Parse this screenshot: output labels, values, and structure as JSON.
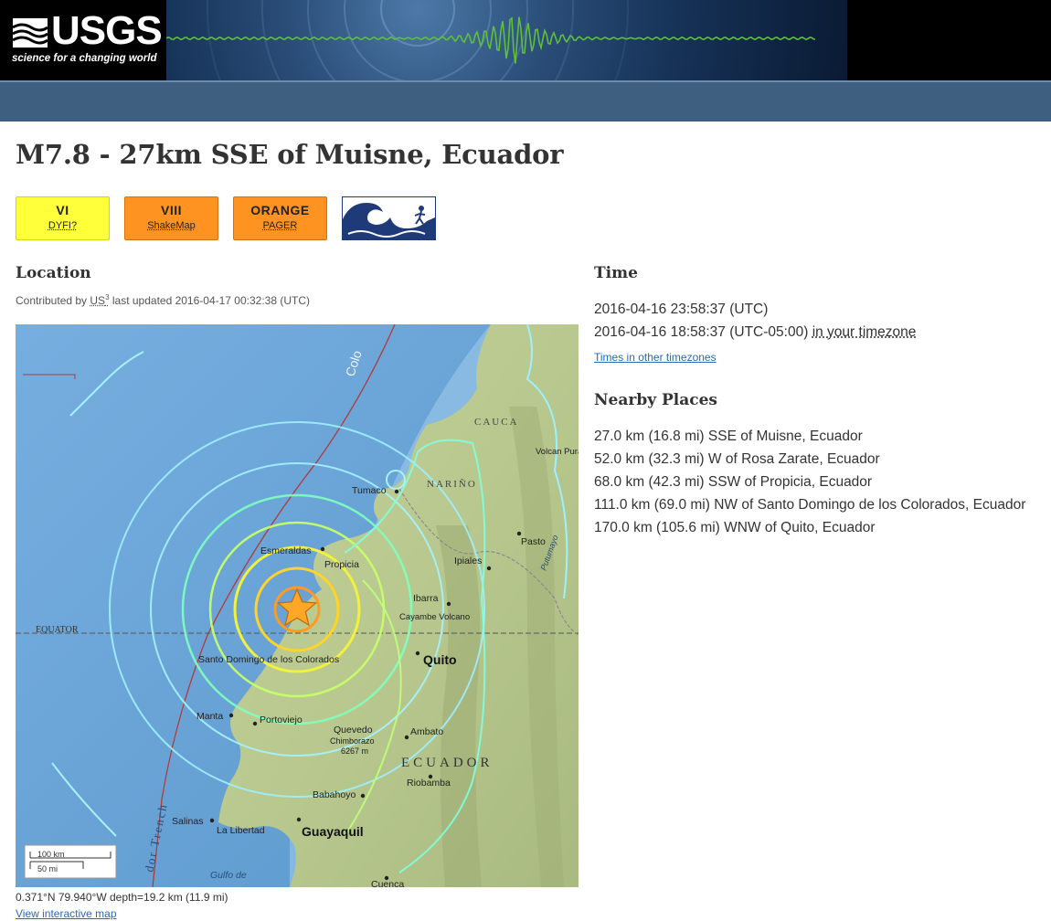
{
  "header": {
    "logo_text": "USGS",
    "tagline": "science for a changing world"
  },
  "event": {
    "title": "M7.8 - 27km SSE of Muisne, Ecuador"
  },
  "badges": {
    "dyfi": {
      "value": "VI",
      "label": "DYFI?",
      "color": "#ffff3a"
    },
    "shakemap": {
      "value": "VIII",
      "label": "ShakeMap",
      "color": "#ff9322"
    },
    "pager": {
      "value": "ORANGE",
      "label": "PAGER",
      "color": "#ff9322"
    },
    "tsunami": {
      "icon": "tsunami-icon"
    }
  },
  "location": {
    "heading": "Location",
    "contributed_prefix": "Contributed by",
    "source": "US",
    "source_sup": "3",
    "updated": "last updated 2016-04-17 00:32:38 (UTC)",
    "coords": "0.371°N 79.940°W depth=19.2 km (11.9 mi)",
    "map_link": "View interactive map"
  },
  "map": {
    "scale_km": "100 km",
    "scale_mi": "50 mi",
    "labels": {
      "equator": "EQUATOR",
      "colombia": "Colo",
      "cauca": "CAUCA",
      "narino": "NARIÑO",
      "tumaco": "Tumaco",
      "esmeraldas": "Esmeraldas",
      "propicia": "Propicia",
      "ipiales": "Ipiales",
      "pasto": "Pasto",
      "ibarra": "Ibarra",
      "cayambe": "Cayambe Volcano",
      "quito": "Quito",
      "santo_domingo": "Santo Domingo de los Colorados",
      "manta": "Manta",
      "portoviejo": "Portoviejo",
      "quevedo": "Quevedo",
      "chimborazo": "Chimborazo",
      "chimborazo_elev": "6267 m",
      "ambato": "Ambato",
      "ecuador": "ECUADOR",
      "riobamba": "Riobamba",
      "babahoyo": "Babahoyo",
      "salinas": "Salinas",
      "la_libertad": "La Libertad",
      "guayaquil": "Guayaquil",
      "gulf": "Gulfo de",
      "cuenca": "Cuenca",
      "trench": "dor Trench",
      "volcan_puracé": "Volcan Puracé",
      "putumayo": "Putumayo"
    }
  },
  "time": {
    "heading": "Time",
    "utc": "2016-04-16 23:58:37 (UTC)",
    "local": "2016-04-16 18:58:37 (UTC-05:00)",
    "tz_link": "in your timezone",
    "other_link": "Times in other timezones"
  },
  "nearby": {
    "heading": "Nearby Places",
    "places": [
      "27.0 km (16.8 mi) SSE of Muisne, Ecuador",
      "52.0 km (32.3 mi) W of Rosa Zarate, Ecuador",
      "68.0 km (42.3 mi) SSW of Propicia, Ecuador",
      "111.0 km (69.0 mi) NW of Santo Domingo de los Colorados, Ecuador",
      "170.0 km (105.6 mi) WNW of Quito, Ecuador"
    ]
  }
}
